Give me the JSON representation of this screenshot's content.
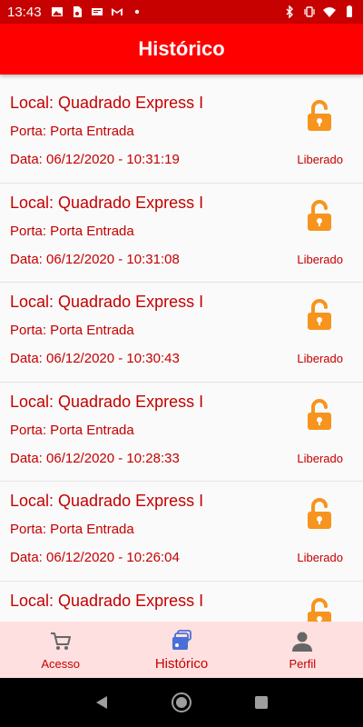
{
  "status_bar": {
    "time": "13:43",
    "left_icons": [
      "gallery-icon",
      "sim-icon",
      "sd-card-icon",
      "gmail-icon",
      "dot-icon"
    ],
    "right_icons": [
      "bluetooth-icon",
      "vibrate-icon",
      "wifi-icon",
      "battery-icon"
    ]
  },
  "header": {
    "title": "Histórico"
  },
  "history": [
    {
      "local": "Local: Quadrado Express I",
      "porta": "Porta: Porta Entrada",
      "data": "Data: 06/12/2020 - 10:31:19",
      "status": "Liberado"
    },
    {
      "local": "Local: Quadrado Express I",
      "porta": "Porta: Porta Entrada",
      "data": "Data: 06/12/2020 - 10:31:08",
      "status": "Liberado"
    },
    {
      "local": "Local: Quadrado Express I",
      "porta": "Porta: Porta Entrada",
      "data": "Data: 06/12/2020 - 10:30:43",
      "status": "Liberado"
    },
    {
      "local": "Local: Quadrado Express I",
      "porta": "Porta: Porta Entrada",
      "data": "Data: 06/12/2020 - 10:28:33",
      "status": "Liberado"
    },
    {
      "local": "Local: Quadrado Express I",
      "porta": "Porta: Porta Entrada",
      "data": "Data: 06/12/2020 - 10:26:04",
      "status": "Liberado"
    },
    {
      "local": "Local: Quadrado Express I",
      "porta": "",
      "data": "",
      "status": ""
    }
  ],
  "bottom_nav": {
    "items": [
      {
        "label": "Acesso",
        "icon": "cart-icon",
        "active": false
      },
      {
        "label": "Histórico",
        "icon": "cards-icon",
        "active": true
      },
      {
        "label": "Perfil",
        "icon": "person-icon",
        "active": false
      }
    ]
  },
  "colors": {
    "status_bar": "#c70000",
    "app_bar": "#ff0000",
    "text_red": "#c40000",
    "lock_orange": "#f7941d",
    "bottom_nav_bg": "#ffe0e0",
    "nav_icon_grey": "#666666",
    "active_icon_blue": "#4a6fd8"
  }
}
